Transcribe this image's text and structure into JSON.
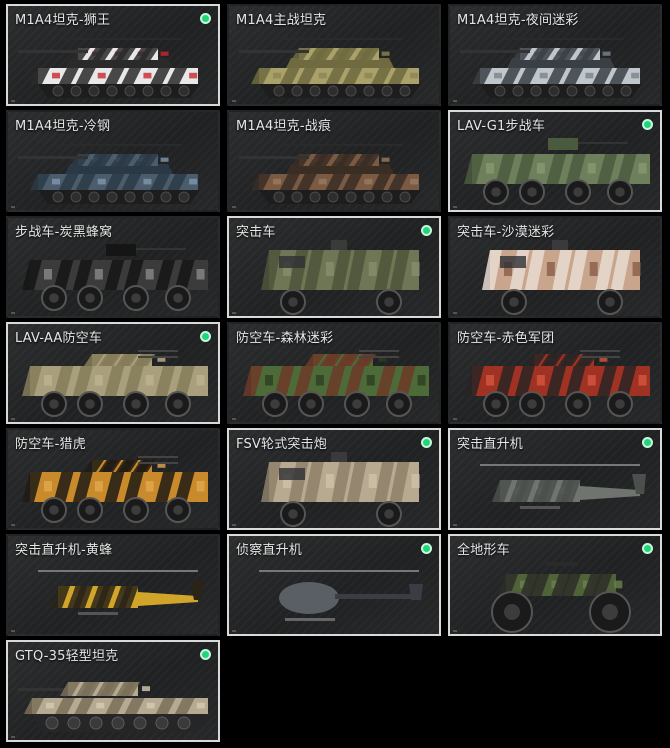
{
  "vehicles": [
    {
      "name": "M1A4坦克-狮王",
      "owned": true,
      "kind": "tank",
      "camo": [
        "#e8e8e8",
        "#2a2a2a",
        "#c7282c"
      ]
    },
    {
      "name": "M1A4主战坦克",
      "owned": false,
      "kind": "tank",
      "camo": [
        "#a9a06a",
        "#6f6a3f",
        "#8c8455"
      ]
    },
    {
      "name": "M1A4坦克-夜间迷彩",
      "owned": false,
      "kind": "tank",
      "camo": [
        "#bfc6cc",
        "#3a3f44",
        "#7a838b"
      ]
    },
    {
      "name": "M1A4坦克-冷钢",
      "owned": false,
      "kind": "tank",
      "camo": [
        "#4b5d6d",
        "#2b3947",
        "#7f98ac"
      ]
    },
    {
      "name": "M1A4坦克-战痕",
      "owned": false,
      "kind": "tank",
      "camo": [
        "#7a5a43",
        "#3a2d24",
        "#9a7a5e"
      ]
    },
    {
      "name": "LAV-G1步战车",
      "owned": true,
      "kind": "ifv",
      "camo": [
        "#6e7f5c",
        "#4a5a3e",
        "#889a70"
      ]
    },
    {
      "name": "步战车-炭黑蜂窝",
      "owned": false,
      "kind": "ifv",
      "camo": [
        "#3b3b3b",
        "#151515",
        "#8a8a8a"
      ]
    },
    {
      "name": "突击车",
      "owned": true,
      "kind": "truck",
      "camo": [
        "#6e7656",
        "#4d553b",
        "#868e6c"
      ]
    },
    {
      "name": "突击车-沙漠迷彩",
      "owned": false,
      "kind": "truck",
      "camo": [
        "#c9a58e",
        "#e9dcd2",
        "#8a5e48"
      ]
    },
    {
      "name": "LAV-AA防空车",
      "owned": true,
      "kind": "aa",
      "camo": [
        "#a99f7c",
        "#857b59",
        "#bdb391"
      ]
    },
    {
      "name": "防空车-森林迷彩",
      "owned": false,
      "kind": "aa",
      "camo": [
        "#4d6b38",
        "#6c3a28",
        "#2d3d20"
      ]
    },
    {
      "name": "防空车-赤色军团",
      "owned": false,
      "kind": "aa",
      "camo": [
        "#a03224",
        "#2a2524",
        "#d4553f"
      ]
    },
    {
      "name": "防空车-猎虎",
      "owned": false,
      "kind": "aa",
      "camo": [
        "#c98a2b",
        "#1e1a14",
        "#e0a850"
      ]
    },
    {
      "name": "FSV轮式突击炮",
      "owned": true,
      "kind": "truck",
      "camo": [
        "#b8aa90",
        "#8d806a",
        "#cfc2a8"
      ]
    },
    {
      "name": "突击直升机",
      "owned": true,
      "kind": "heli",
      "camo": [
        "#6f746f",
        "#4b504c",
        "#8f958f"
      ]
    },
    {
      "name": "突击直升机-黄蜂",
      "owned": false,
      "kind": "heli",
      "camo": [
        "#d1a52a",
        "#2a2418",
        "#e6c050"
      ]
    },
    {
      "name": "侦察直升机",
      "owned": true,
      "kind": "scout",
      "camo": [
        "#5a5f66",
        "#3a3e44",
        "#7c828a"
      ]
    },
    {
      "name": "全地形车",
      "owned": true,
      "kind": "atv",
      "camo": [
        "#4f6238",
        "#2b2e28",
        "#6d8150"
      ]
    },
    {
      "name": "GTQ-35轻型坦克",
      "owned": true,
      "kind": "lighttank",
      "camo": [
        "#b6ab92",
        "#7a6f58",
        "#d6ccb4"
      ]
    }
  ]
}
